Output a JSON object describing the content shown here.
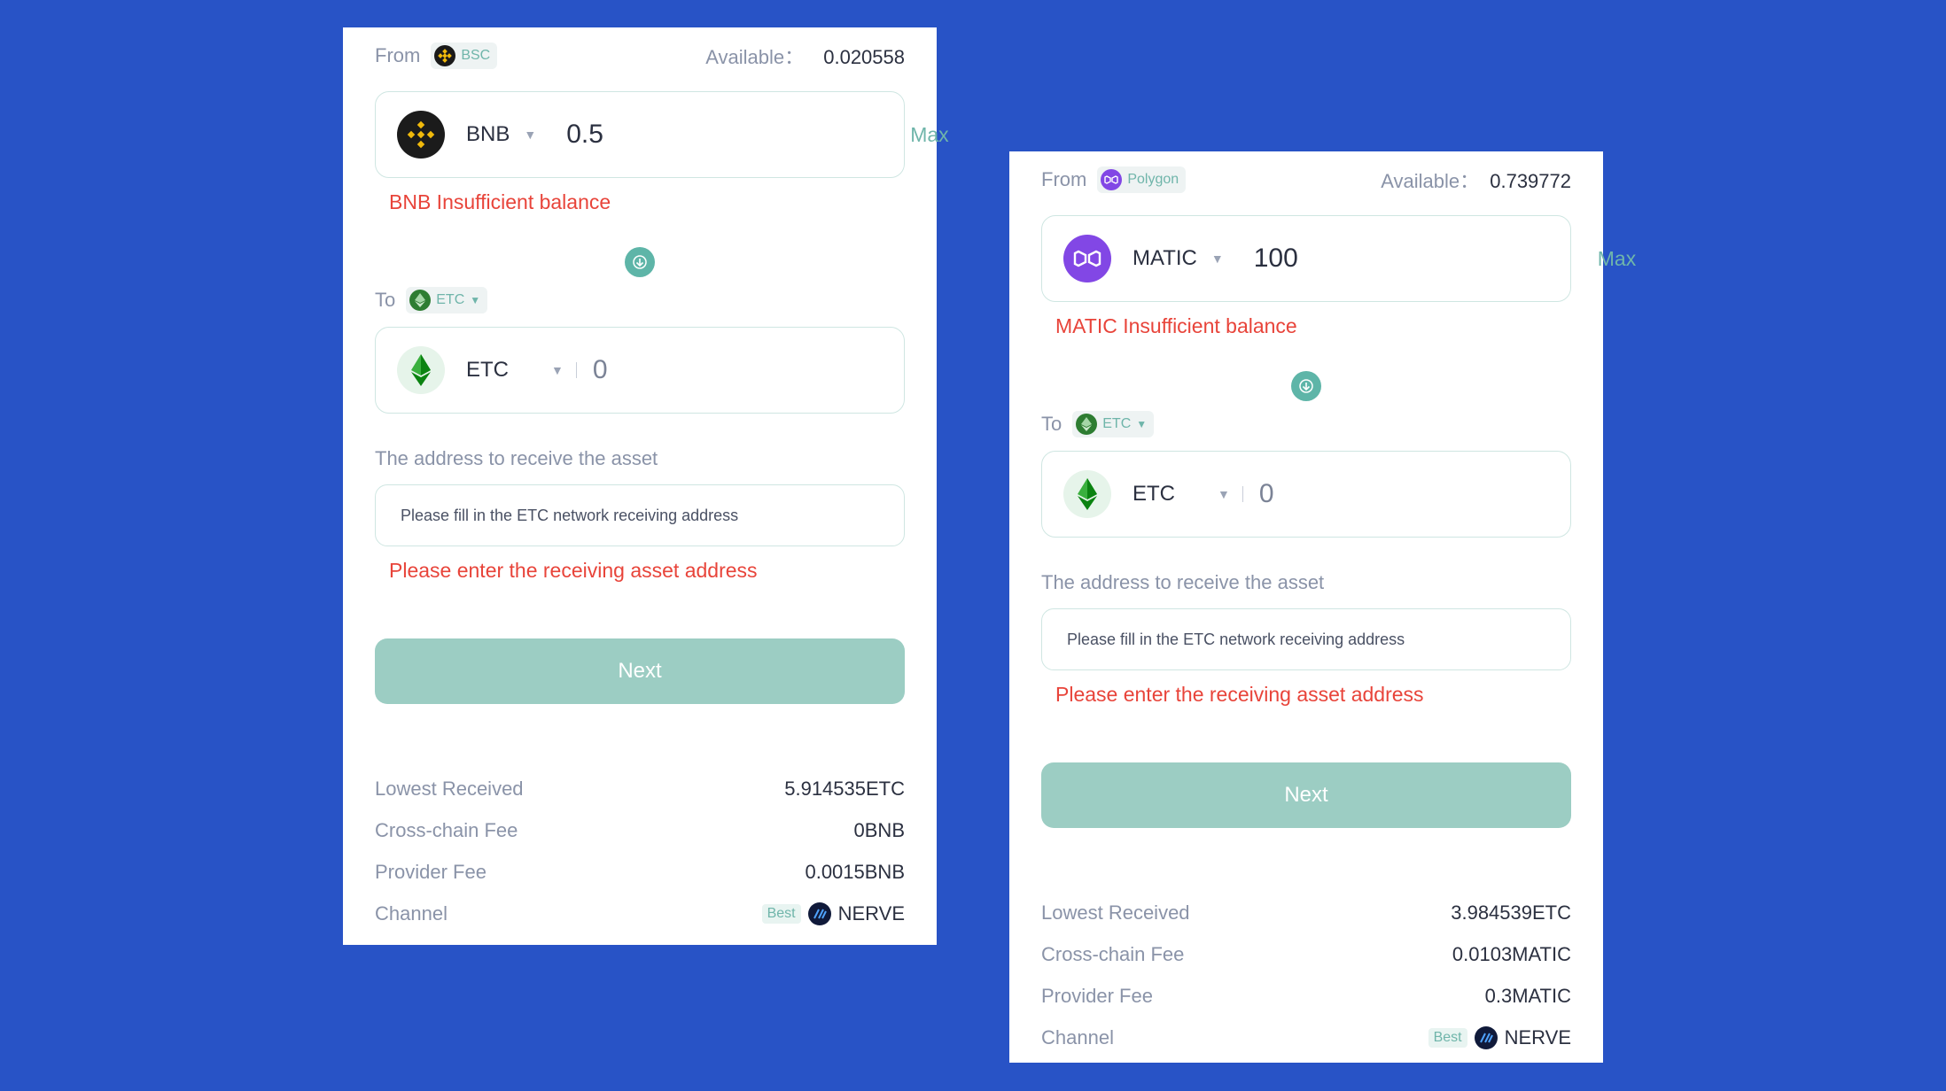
{
  "colors": {
    "background": "#2853c6",
    "accent": "#6fb5aa",
    "error": "#e8443a",
    "button": "#9ccdc3"
  },
  "cards": [
    {
      "from_label": "From",
      "from_chain": "BSC",
      "available_label": "Available：",
      "available_value": "0.020558",
      "from_token": {
        "name": "BNB",
        "icon": "bnb-icon",
        "amount": "0.5",
        "max_label": "Max"
      },
      "balance_error": "BNB Insufficient balance",
      "to_label": "To",
      "to_chain": "ETC",
      "to_token": {
        "name": "ETC",
        "icon": "etc-icon",
        "amount": "0"
      },
      "address_label": "The address to receive the asset",
      "address_placeholder": "Please fill in the ETC network receiving address",
      "address_error": "Please enter the receiving asset address",
      "next_label": "Next",
      "info": {
        "lowest_received_label": "Lowest Received",
        "lowest_received_value": "5.914535ETC",
        "cross_chain_fee_label": "Cross-chain Fee",
        "cross_chain_fee_value": "0BNB",
        "provider_fee_label": "Provider Fee",
        "provider_fee_value": "0.0015BNB",
        "channel_label": "Channel",
        "channel_badge": "Best",
        "channel_value": "NERVE"
      }
    },
    {
      "from_label": "From",
      "from_chain": "Polygon",
      "available_label": "Available：",
      "available_value": "0.739772",
      "from_token": {
        "name": "MATIC",
        "icon": "matic-icon",
        "amount": "100",
        "max_label": "Max"
      },
      "balance_error": "MATIC Insufficient balance",
      "to_label": "To",
      "to_chain": "ETC",
      "to_token": {
        "name": "ETC",
        "icon": "etc-icon",
        "amount": "0"
      },
      "address_label": "The address to receive the asset",
      "address_placeholder": "Please fill in the ETC network receiving address",
      "address_error": "Please enter the receiving asset address",
      "next_label": "Next",
      "info": {
        "lowest_received_label": "Lowest Received",
        "lowest_received_value": "3.984539ETC",
        "cross_chain_fee_label": "Cross-chain Fee",
        "cross_chain_fee_value": "0.0103MATIC",
        "provider_fee_label": "Provider Fee",
        "provider_fee_value": "0.3MATIC",
        "channel_label": "Channel",
        "channel_badge": "Best",
        "channel_value": "NERVE"
      }
    }
  ]
}
